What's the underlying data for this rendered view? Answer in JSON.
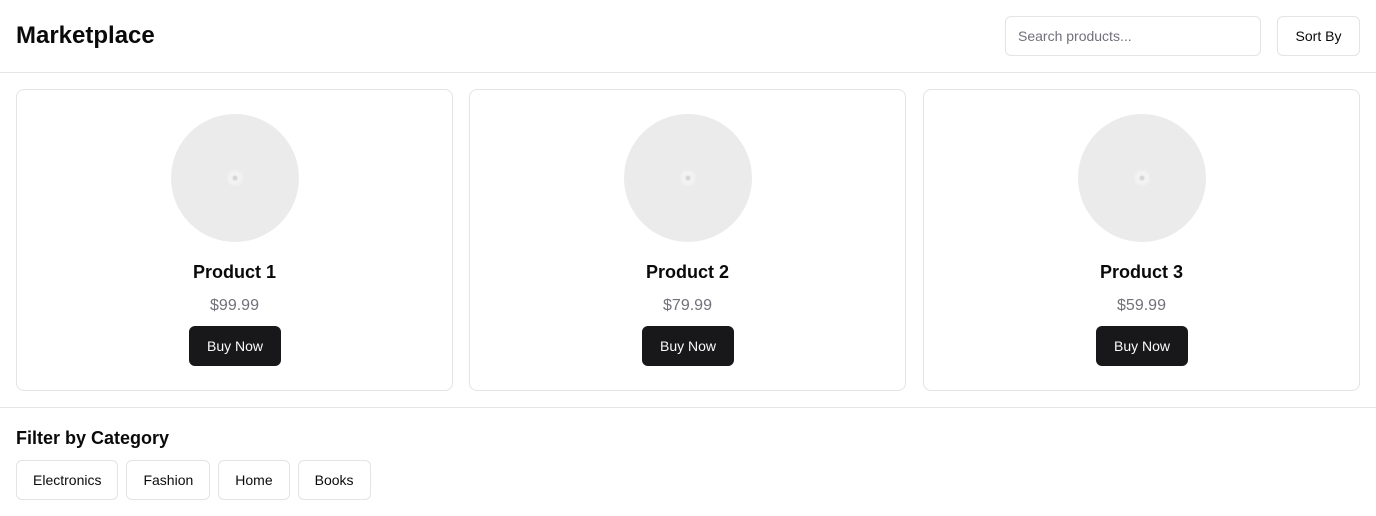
{
  "header": {
    "title": "Marketplace",
    "search_placeholder": "Search products...",
    "search_value": "",
    "sort_label": "Sort By"
  },
  "products": [
    {
      "name": "Product 1",
      "price": "$99.99",
      "buy_label": "Buy Now"
    },
    {
      "name": "Product 2",
      "price": "$79.99",
      "buy_label": "Buy Now"
    },
    {
      "name": "Product 3",
      "price": "$59.99",
      "buy_label": "Buy Now"
    }
  ],
  "filter": {
    "heading": "Filter by Category",
    "categories": [
      "Electronics",
      "Fashion",
      "Home",
      "Books"
    ]
  },
  "colors": {
    "primary_button": "#18181b",
    "border": "#e4e4e7",
    "muted_text": "#71717a",
    "image_placeholder": "#ebebeb"
  },
  "icons": {
    "product_image": "image-placeholder-icon"
  }
}
